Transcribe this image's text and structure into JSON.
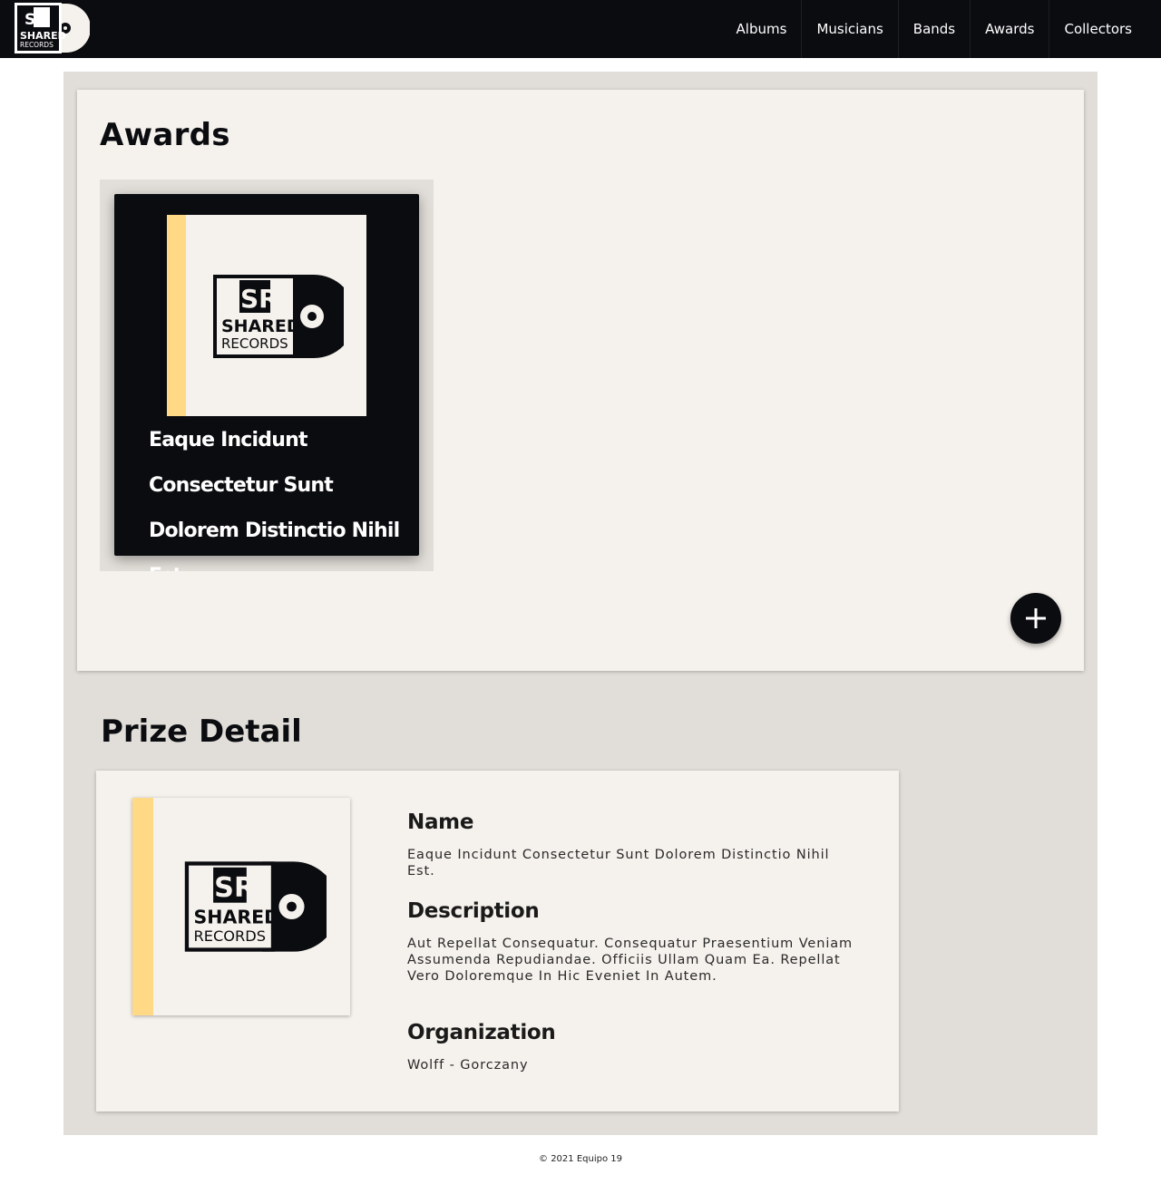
{
  "header": {
    "logo_text_top": "SR",
    "logo_text_mid": "SHARED",
    "logo_text_bottom": "RECORDS",
    "nav": [
      "Albums",
      "Musicians",
      "Bands",
      "Awards",
      "Collectors"
    ]
  },
  "awards": {
    "title": "Awards",
    "items": [
      {
        "name": "Eaque Incidunt Consectetur Sunt Dolorem Distinctio Nihil Est."
      }
    ],
    "add_icon": "plus-icon"
  },
  "detail": {
    "title": "Prize Detail",
    "name_label": "Name",
    "name_value": "Eaque Incidunt Consectetur Sunt Dolorem Distinctio Nihil Est.",
    "description_label": "Description",
    "description_value": "Aut Repellat Consequatur. Consequatur Praesentium Veniam Assumenda Repudiandae. Officiis Ullam Quam Ea. Repellat Vero Doloremque In Hic Eveniet In Autem.",
    "organization_label": "Organization",
    "organization_value": "Wolff - Gorczany"
  },
  "footer": {
    "text": "© 2021 Equipo 19"
  },
  "colors": {
    "dark": "#0b0c10",
    "panel": "#f5f1ec",
    "background": "#e1ddd8",
    "accent": "#ffd985"
  }
}
